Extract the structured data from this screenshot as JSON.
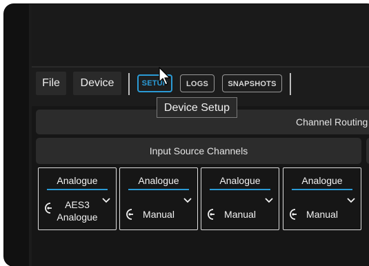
{
  "menu": {
    "file": "File",
    "device": "Device"
  },
  "tabs": [
    {
      "label": "SETUP",
      "active": true
    },
    {
      "label": "LOGS",
      "active": false
    },
    {
      "label": "SNAPSHOTS",
      "active": false
    }
  ],
  "tooltip": "Device Setup",
  "routing": {
    "title": "Channel Routing"
  },
  "input_sources": {
    "title": "Input Source Channels",
    "channels": [
      {
        "type": "Analogue",
        "source_line1": "AES3",
        "source_line2": "Analogue"
      },
      {
        "type": "Analogue",
        "source_line1": "Manual",
        "source_line2": ""
      },
      {
        "type": "Analogue",
        "source_line1": "Manual",
        "source_line2": ""
      },
      {
        "type": "Analogue",
        "source_line1": "Manual",
        "source_line2": ""
      }
    ]
  },
  "colors": {
    "accent": "#2b9bd6",
    "background": "#161616",
    "panel": "#2c2c2c"
  }
}
